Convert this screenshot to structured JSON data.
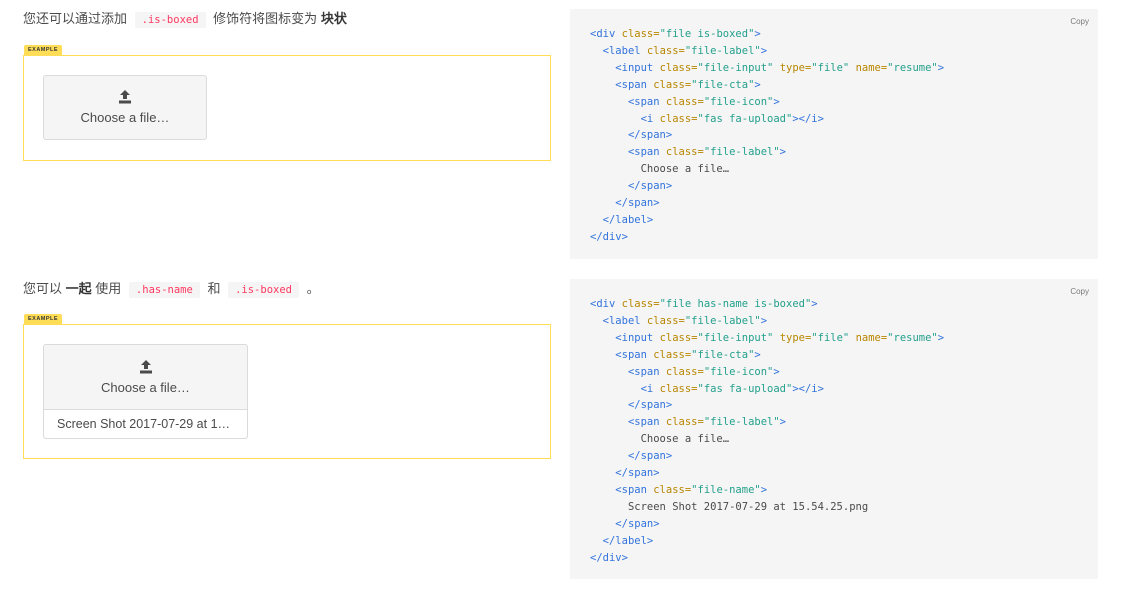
{
  "section1": {
    "intro_pre": "您还可以通过添加",
    "intro_code": ".is-boxed",
    "intro_mid": "修饰符将图标变为",
    "intro_strong": "块状",
    "example_tag": "EXAMPLE",
    "file_label": "Choose a file…",
    "copy_label": "Copy"
  },
  "section2": {
    "intro_pre": "您可以",
    "intro_strong": "一起",
    "intro_mid": "使用",
    "intro_code1": ".has-name",
    "intro_and": "和",
    "intro_code2": ".is-boxed",
    "intro_end": "。",
    "example_tag": "EXAMPLE",
    "file_label": "Choose a file…",
    "file_name": "Screen Shot 2017-07-29 at 15.54.25.png",
    "copy_label": "Copy"
  },
  "code": {
    "div_class_1": "\"file is-boxed\"",
    "div_class_2": "\"file has-name is-boxed\"",
    "label_class": "\"file-label\"",
    "input_class": "\"file-input\"",
    "input_type": "\"file\"",
    "input_name": "\"resume\"",
    "cta_class": "\"file-cta\"",
    "icon_class": "\"file-icon\"",
    "i_class": "\"fas fa-upload\"",
    "label_span_class": "\"file-label\"",
    "label_text": "Choose a file…",
    "name_class": "\"file-name\"",
    "name_text": "Screen Shot 2017-07-29 at 15.54.25.png"
  },
  "icons": {
    "upload": "upload-icon"
  },
  "colors": {
    "example_border": "#ffdd57",
    "code_red": "#ff3860"
  }
}
